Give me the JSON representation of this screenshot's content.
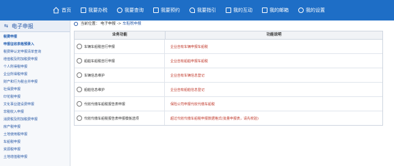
{
  "topnav": {
    "items": [
      {
        "label": "首页",
        "icon": "home-icon"
      },
      {
        "label": "我要办税",
        "icon": "document-icon"
      },
      {
        "label": "我要查询",
        "icon": "search-icon"
      },
      {
        "label": "我要预约",
        "icon": "checkbox-icon"
      },
      {
        "label": "我要指引",
        "icon": "heart-icon"
      },
      {
        "label": "我的互动",
        "icon": "printer-icon"
      },
      {
        "label": "我的邮箱",
        "icon": "mail-icon"
      },
      {
        "label": "我的设置",
        "icon": "gear-icon"
      }
    ]
  },
  "sidebar": {
    "title": "电子申报",
    "items": [
      {
        "label": "税费申报",
        "group": true
      },
      {
        "label": "申报征收表格预录入",
        "group": true
      },
      {
        "label": "税费种认定申报清单查询",
        "group": false
      },
      {
        "label": "增值税及附加税费申报",
        "group": false
      },
      {
        "label": "个人所得税申报",
        "group": false
      },
      {
        "label": "企业所得税申报",
        "group": false
      },
      {
        "label": "财产和行为税合并申报",
        "group": false
      },
      {
        "label": "社保费申报",
        "group": false
      },
      {
        "label": "印花税申报",
        "group": false
      },
      {
        "label": "文化事业建设费申报",
        "group": false
      },
      {
        "label": "非税收入申报",
        "group": false
      },
      {
        "label": "消费税及附加税费申报",
        "group": false
      },
      {
        "label": "房产税申报",
        "group": false
      },
      {
        "label": "土地使用税申报",
        "group": false
      },
      {
        "label": "车船税申报",
        "group": false
      },
      {
        "label": "资源税申报",
        "group": false
      },
      {
        "label": "土地增值税申报",
        "group": false
      }
    ]
  },
  "breadcrumb": {
    "prefix": "当前位置：",
    "path": "电子申报 -> ",
    "current": "车船税申报"
  },
  "table": {
    "headers": [
      "业务功能",
      "功能说明"
    ],
    "rows": [
      {
        "name": "车辆车船税自行申报",
        "desc": "企业自有车辆申报车船税"
      },
      {
        "name": "船舶车船税自行申报",
        "desc": "企业自有船舶申报车船税"
      },
      {
        "name": "车辆信息维护",
        "desc": "企业自有车辆信息登记"
      },
      {
        "name": "船舶信息维护",
        "desc": "企业自有船舶信息登记"
      },
      {
        "name": "代收代缴车船税报告表申报",
        "desc": "保险公司申报代收代缴车船税"
      },
      {
        "name": "代收代缴车船税报告表申报模板选项",
        "desc": "超过代收代缴车船税申报数据格式(批量申报表，请先校验)"
      }
    ]
  }
}
